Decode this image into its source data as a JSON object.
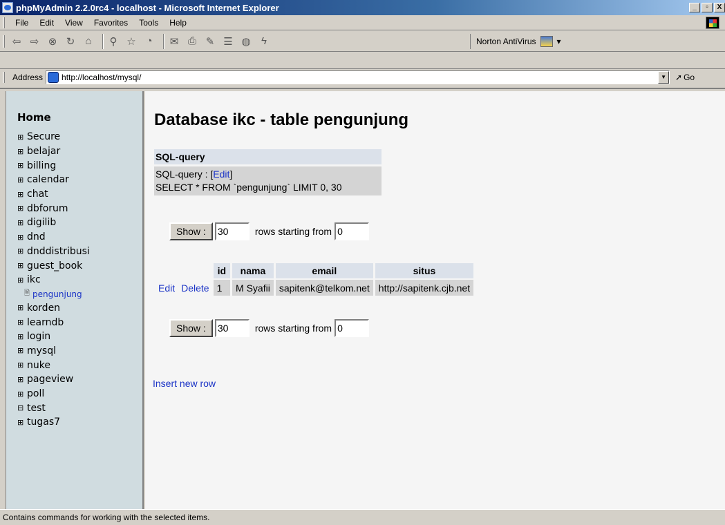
{
  "window": {
    "title": "phpMyAdmin 2.2.0rc4 - localhost - Microsoft Internet Explorer",
    "buttons": [
      "_",
      "Д",
      "X"
    ]
  },
  "menu": [
    "File",
    "Edit",
    "View",
    "Favorites",
    "Tools",
    "Help"
  ],
  "toolbar": {
    "norton_label": "Norton AntiVirus"
  },
  "address": {
    "label": "Address",
    "url": "http://localhost/mysql/",
    "go_label": "Go"
  },
  "sidebar": {
    "home": "Home",
    "databases": [
      "Secure",
      "belajar",
      "billing",
      "calendar",
      "chat",
      "dbforum",
      "digilib",
      "dnd",
      "dnddistribusi",
      "guest_book",
      "ikc"
    ],
    "active_table": "pengunjung",
    "databases_after": [
      "korden",
      "learndb",
      "login",
      "mysql",
      "nuke",
      "pageview",
      "poll",
      "test",
      "tugas7"
    ]
  },
  "main": {
    "title": "Database ikc - table pengunjung",
    "sql_header": "SQL-query",
    "sql_label": "SQL-query : [",
    "sql_edit": "Edit",
    "sql_label_end": "]",
    "sql_text": "SELECT * FROM `pengunjung` LIMIT 0, 30",
    "show_label": "Show :",
    "rows_value": "30",
    "rows_starting_label": "rows starting from",
    "start_value": "0",
    "columns": [
      "id",
      "nama",
      "email",
      "situs"
    ],
    "rows": [
      {
        "edit": "Edit",
        "delete": "Delete",
        "id": "1",
        "nama": "M Syafii",
        "email": "sapitenk@telkom.net",
        "situs": "http://sapitenk.cjb.net"
      }
    ],
    "insert_label": "Insert new row"
  },
  "status": "Contains commands for working with the selected items."
}
